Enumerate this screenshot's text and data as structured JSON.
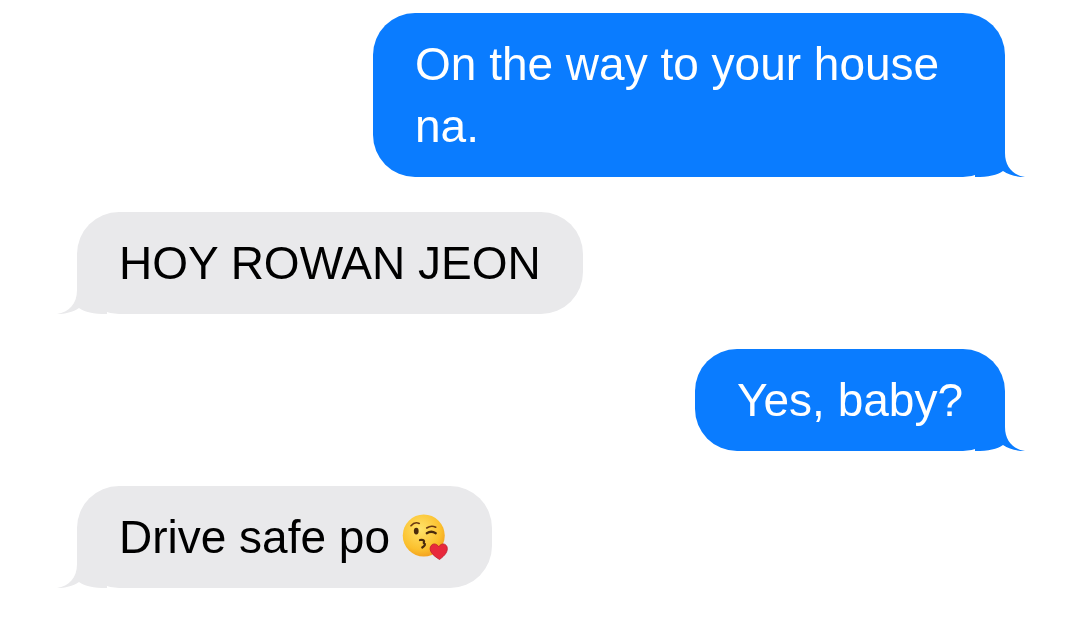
{
  "messages": [
    {
      "kind": "sent",
      "text": "On the way to your house na.",
      "emoji": false
    },
    {
      "kind": "received",
      "text": "HOY ROWAN JEON",
      "emoji": false
    },
    {
      "kind": "sent",
      "text": "Yes, baby?",
      "emoji": false
    },
    {
      "kind": "received",
      "text": "Drive safe po",
      "emoji": true
    }
  ]
}
